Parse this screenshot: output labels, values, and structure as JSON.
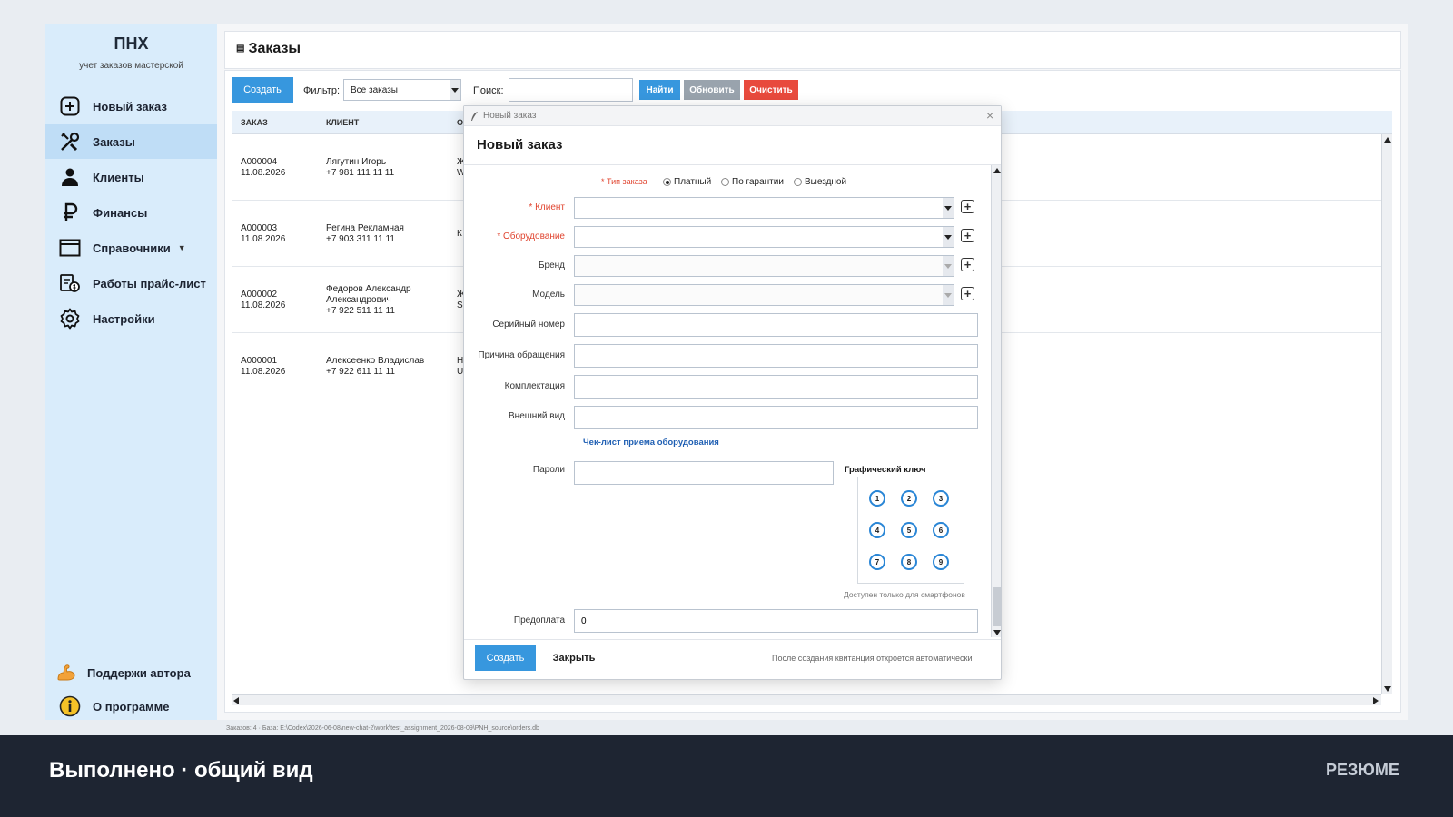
{
  "app": {
    "name": "ПНХ",
    "subtitle": "учет заказов мастерской"
  },
  "sidebar": {
    "items": [
      {
        "label": "Новый заказ",
        "icon": "plus-square-icon"
      },
      {
        "label": "Заказы",
        "icon": "tools-icon",
        "active": true
      },
      {
        "label": "Клиенты",
        "icon": "user-icon"
      },
      {
        "label": "Финансы",
        "icon": "ruble-icon"
      },
      {
        "label": "Справочники",
        "icon": "window-icon",
        "has_dropdown": true
      },
      {
        "label": "Работы прайс-лист",
        "icon": "price-list-icon"
      },
      {
        "label": "Настройки",
        "icon": "gear-icon"
      }
    ],
    "bottom": [
      {
        "label": "Поддержи автора",
        "icon": "muscle-icon"
      },
      {
        "label": "О программе",
        "icon": "info-icon"
      }
    ]
  },
  "page": {
    "title": "Заказы"
  },
  "toolbar": {
    "create_label": "Создать",
    "filter_label": "Фильтр:",
    "filter_value": "Все заказы",
    "search_label": "Поиск:",
    "search_value": "",
    "find_label": "Найти",
    "refresh_label": "Обновить",
    "clear_label": "Очистить"
  },
  "table": {
    "columns": [
      "ЗАКАЗ",
      "КЛИЕНТ",
      "О"
    ],
    "rows": [
      {
        "order": "A000004",
        "date": "11.08.2026",
        "client": [
          "Лягутин Игорь",
          "+7 981 111 11 11"
        ],
        "extra": [
          "Ж",
          "W"
        ]
      },
      {
        "order": "A000003",
        "date": "11.08.2026",
        "client": [
          "Регина Рекламная",
          "+7 903 311 11 11"
        ],
        "extra": [
          "К",
          ""
        ]
      },
      {
        "order": "A000002",
        "date": "11.08.2026",
        "client": [
          "Федоров Александр",
          "Александрович",
          "+7 922 511 11 11"
        ],
        "extra": [
          "Ж",
          "S"
        ]
      },
      {
        "order": "A000001",
        "date": "11.08.2026",
        "client": [
          "Алексеенко Владислав",
          "+7 922 611 11 11"
        ],
        "extra": [
          "Н",
          "U"
        ]
      }
    ]
  },
  "modal": {
    "window_title": "Новый заказ",
    "heading": "Новый заказ",
    "order_type_label": "* Тип заказа",
    "order_types": [
      {
        "label": "Платный",
        "selected": true
      },
      {
        "label": "По гарантии",
        "selected": false
      },
      {
        "label": "Выездной",
        "selected": false
      }
    ],
    "fields": {
      "client": "* Клиент",
      "equipment": "* Оборудование",
      "brand": "Бренд",
      "model": "Модель",
      "serial": "Серийный номер",
      "reason": "Причина обращения",
      "kit": "Комплектация",
      "appearance": "Внешний вид",
      "passwords": "Пароли",
      "prepayment": "Предоплата"
    },
    "prepayment_value": "0",
    "checklist_link": "Чек-лист приема оборудования",
    "pattern_title": "Графический ключ",
    "pattern_dots": [
      "1",
      "2",
      "3",
      "4",
      "5",
      "6",
      "7",
      "8",
      "9"
    ],
    "pattern_note": "Доступен только для смартфонов",
    "create_label": "Создать",
    "close_label": "Закрыть",
    "footer_note": "После создания квитанция откроется автоматически"
  },
  "statusbar": "Заказов: 4 · База: E:\\Codex\\2026-06-08\\new-chat-2\\work\\test_assignment_2026-08-09\\PNH_source\\orders.db",
  "banner": {
    "title": "Выполнено · общий вид",
    "tag": "РЕЗЮМЕ"
  },
  "colors": {
    "sidebar_bg": "#d9ecfb",
    "sidebar_active": "#bfddf6",
    "primary": "#3797de",
    "find": "#3797de",
    "refresh": "#99a3ad",
    "clear": "#e84a3d",
    "required": "#e0442f",
    "link": "#1f5fb3",
    "banner_bg": "#1e2532"
  }
}
